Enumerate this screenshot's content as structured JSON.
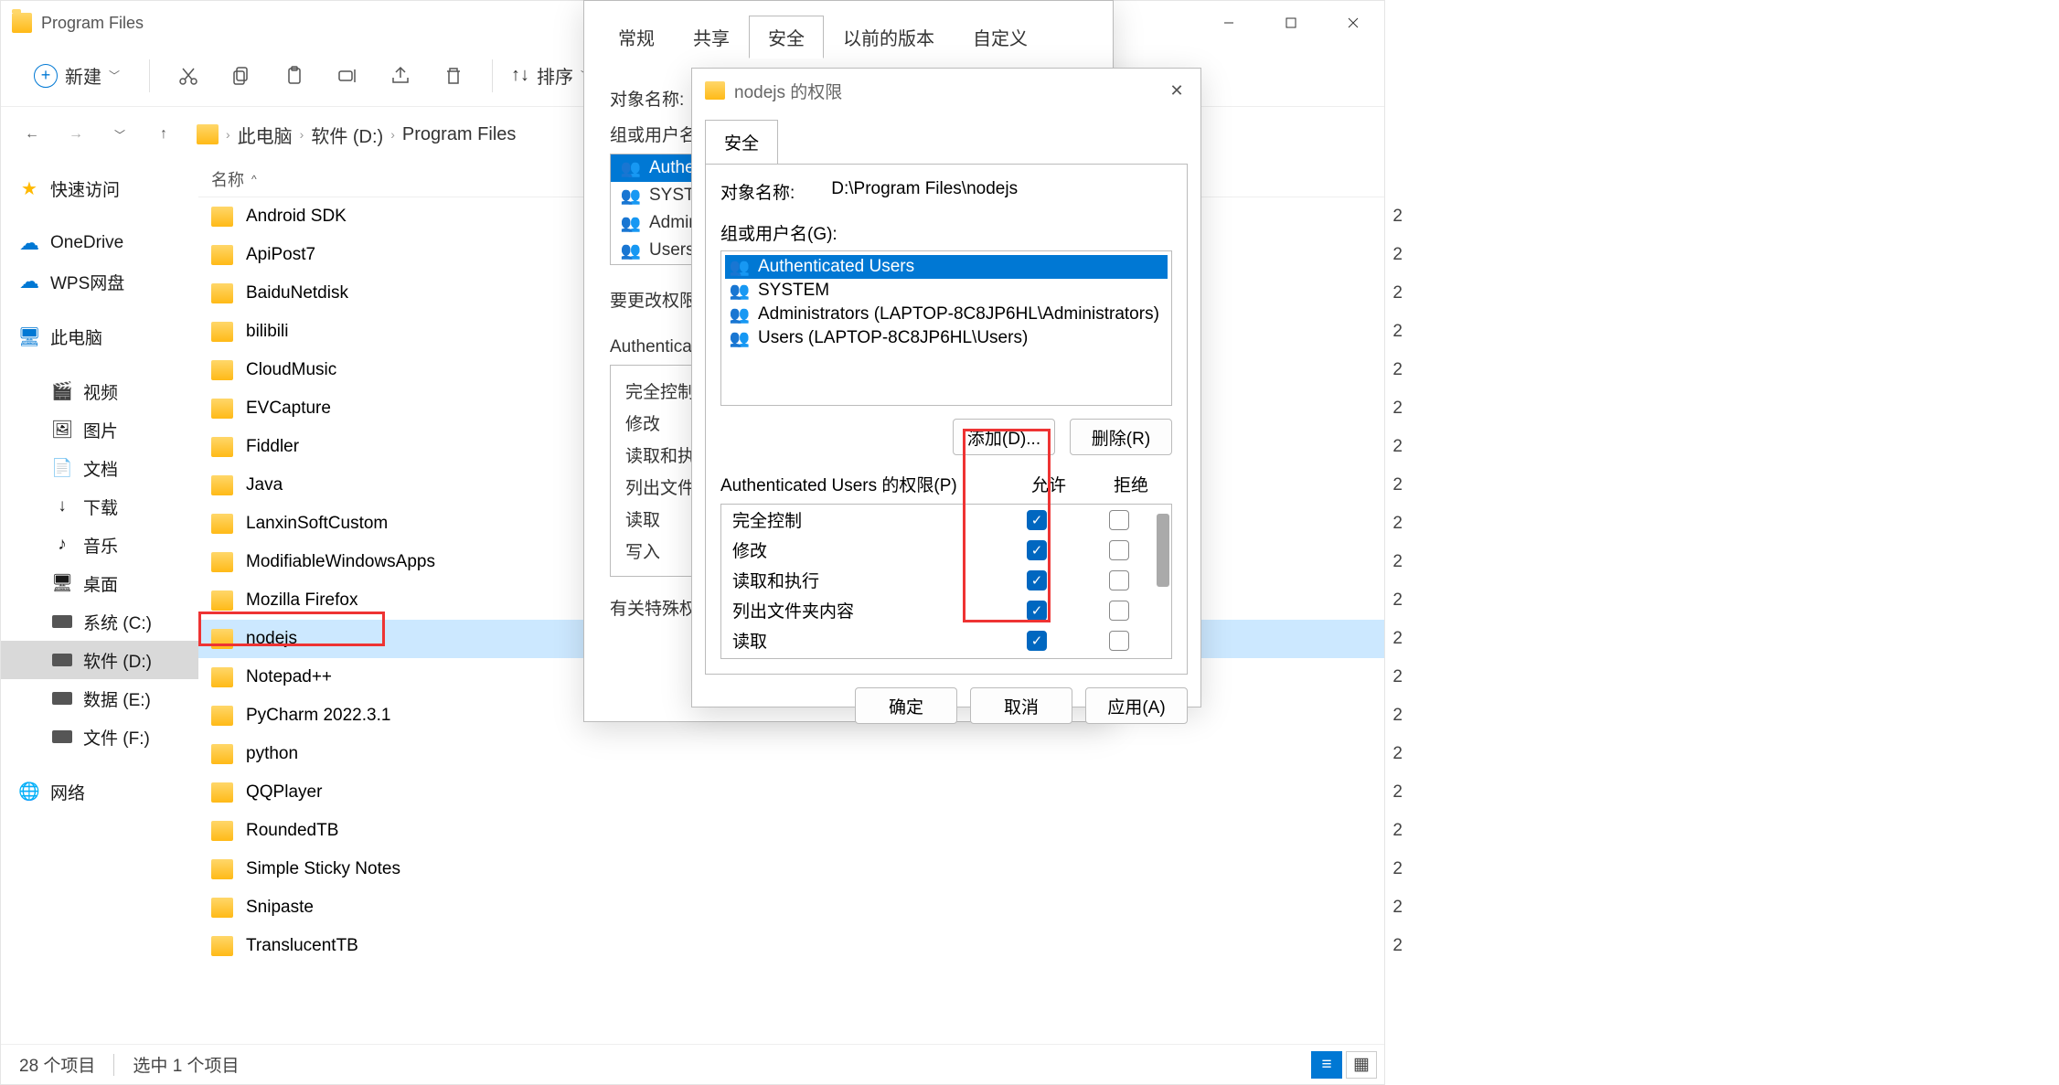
{
  "window": {
    "title": "Program Files"
  },
  "toolbar": {
    "new_label": "新建",
    "sort_label": "排序"
  },
  "breadcrumb": {
    "parts": [
      "此电脑",
      "软件 (D:)",
      "Program Files"
    ]
  },
  "sidebar": {
    "items": [
      {
        "label": "快速访问",
        "icon": "star"
      },
      {
        "label": "OneDrive",
        "icon": "cloud"
      },
      {
        "label": "WPS网盘",
        "icon": "cloud"
      },
      {
        "label": "此电脑",
        "icon": "monitor"
      },
      {
        "label": "视频",
        "icon": "video",
        "indent": true
      },
      {
        "label": "图片",
        "icon": "pic",
        "indent": true
      },
      {
        "label": "文档",
        "icon": "doc",
        "indent": true
      },
      {
        "label": "下载",
        "icon": "download",
        "indent": true
      },
      {
        "label": "音乐",
        "icon": "music",
        "indent": true
      },
      {
        "label": "桌面",
        "icon": "desktop",
        "indent": true
      },
      {
        "label": "系统 (C:)",
        "icon": "disk",
        "indent": true
      },
      {
        "label": "软件 (D:)",
        "icon": "disk",
        "indent": true,
        "selected": true
      },
      {
        "label": "数据 (E:)",
        "icon": "disk",
        "indent": true
      },
      {
        "label": "文件 (F:)",
        "icon": "disk",
        "indent": true
      },
      {
        "label": "网络",
        "icon": "network"
      }
    ]
  },
  "filelist": {
    "col_name": "名称",
    "items": [
      {
        "name": "Android SDK",
        "date": "2"
      },
      {
        "name": "ApiPost7",
        "date": "2"
      },
      {
        "name": "BaiduNetdisk",
        "date": "2"
      },
      {
        "name": "bilibili",
        "date": "2"
      },
      {
        "name": "CloudMusic",
        "date": "2"
      },
      {
        "name": "EVCapture",
        "date": "2"
      },
      {
        "name": "Fiddler",
        "date": "2"
      },
      {
        "name": "Java",
        "date": "2"
      },
      {
        "name": "LanxinSoftCustom",
        "date": "2"
      },
      {
        "name": "ModifiableWindowsApps",
        "date": "2"
      },
      {
        "name": "Mozilla Firefox",
        "date": "2"
      },
      {
        "name": "nodejs",
        "date": "2",
        "selected": true,
        "highlight": true
      },
      {
        "name": "Notepad++",
        "date": "2"
      },
      {
        "name": "PyCharm 2022.3.1",
        "date": "2"
      },
      {
        "name": "python",
        "date": "2"
      },
      {
        "name": "QQPlayer",
        "date": "2"
      },
      {
        "name": "RoundedTB",
        "date": "2"
      },
      {
        "name": "Simple Sticky Notes",
        "date": "2"
      },
      {
        "name": "Snipaste",
        "date": "2"
      },
      {
        "name": "TranslucentTB",
        "date": "2"
      }
    ]
  },
  "statusbar": {
    "count": "28 个项目",
    "selection": "选中 1 个项目"
  },
  "dialog1": {
    "tabs": [
      "常规",
      "共享",
      "安全",
      "以前的版本",
      "自定义"
    ],
    "active_tab": 2,
    "object_label": "对象名称:",
    "group_label": "组或用户名",
    "groups": [
      {
        "label": "Authen"
      },
      {
        "label": "SYSTE"
      },
      {
        "label": "Admin"
      },
      {
        "label": "Users"
      }
    ],
    "change_label": "要更改权限",
    "auth_label": "Authentica",
    "perms": [
      "完全控制",
      "修改",
      "读取和执",
      "列出文件",
      "读取",
      "写入"
    ],
    "special_label": "有关特殊权"
  },
  "dialog2": {
    "title": "nodejs 的权限",
    "tab": "安全",
    "object_label": "对象名称:",
    "object_path": "D:\\Program Files\\nodejs",
    "group_label": "组或用户名(G):",
    "groups": [
      {
        "label": "Authenticated Users",
        "selected": true
      },
      {
        "label": "SYSTEM"
      },
      {
        "label": "Administrators (LAPTOP-8C8JP6HL\\Administrators)"
      },
      {
        "label": "Users (LAPTOP-8C8JP6HL\\Users)"
      }
    ],
    "add_btn": "添加(D)...",
    "remove_btn": "删除(R)",
    "perm_title": "Authenticated Users 的权限(P)",
    "allow": "允许",
    "deny": "拒绝",
    "perms": [
      {
        "name": "完全控制",
        "allow": true,
        "deny": false
      },
      {
        "name": "修改",
        "allow": true,
        "deny": false
      },
      {
        "name": "读取和执行",
        "allow": true,
        "deny": false
      },
      {
        "name": "列出文件夹内容",
        "allow": true,
        "deny": false
      },
      {
        "name": "读取",
        "allow": true,
        "deny": false
      }
    ],
    "ok": "确定",
    "cancel": "取消",
    "apply": "应用(A)"
  }
}
